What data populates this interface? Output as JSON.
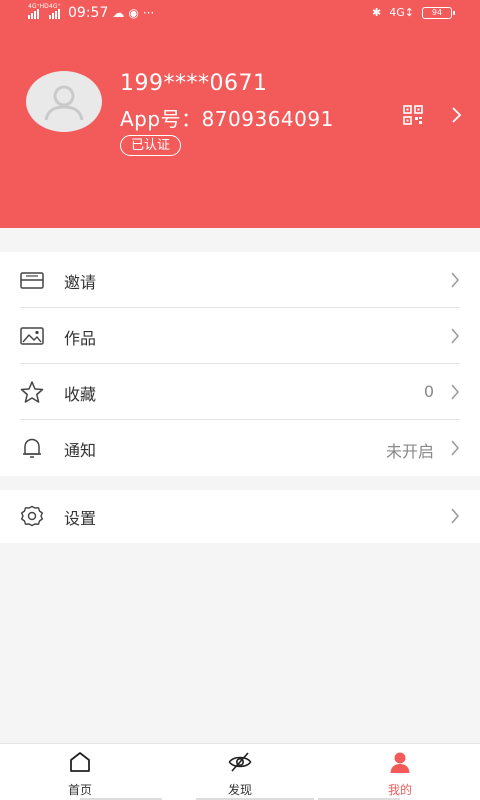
{
  "status_bar": {
    "network1": "4G⁺HD",
    "network2": "4G⁺",
    "time": "09:57",
    "more": "···",
    "cellular": "4G↕",
    "battery": "94"
  },
  "profile": {
    "phone": "199****0671",
    "app_no": "App号：8709364091",
    "verified_badge": "已认证"
  },
  "menu": [
    {
      "label": "邀请",
      "value": "",
      "icon": "invite-mail-icon"
    },
    {
      "label": "作品",
      "value": "",
      "icon": "works-image-icon"
    },
    {
      "label": "收藏",
      "value": "0",
      "icon": "star-icon"
    },
    {
      "label": "通知",
      "value": "未开启",
      "icon": "bell-icon"
    }
  ],
  "settings": {
    "label": "设置",
    "icon": "gear-icon"
  },
  "tabbar": {
    "tabs": [
      {
        "label": "首页",
        "icon": "home-icon"
      },
      {
        "label": "发现",
        "icon": "discover-eye-icon"
      },
      {
        "label": "我的",
        "icon": "profile-person-icon"
      }
    ]
  },
  "colors": {
    "accent": "#f35b5b",
    "background": "#f5f5f5"
  }
}
